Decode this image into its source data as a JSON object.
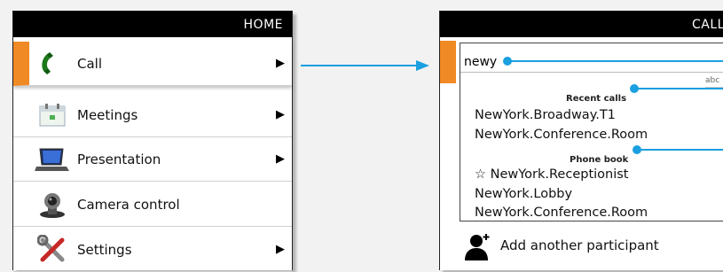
{
  "home": {
    "title": "HOME",
    "items": [
      {
        "label": "Call",
        "icon": "phone-icon",
        "active": true,
        "has_arrow": true
      },
      {
        "label": "Meetings",
        "icon": "calendar-icon",
        "active": false,
        "has_arrow": true
      },
      {
        "label": "Presentation",
        "icon": "laptop-icon",
        "active": false,
        "has_arrow": true
      },
      {
        "label": "Camera control",
        "icon": "camera-icon",
        "active": false,
        "has_arrow": false
      },
      {
        "label": "Settings",
        "icon": "tools-icon",
        "active": false,
        "has_arrow": true
      }
    ],
    "arrow_glyph": "▶"
  },
  "call": {
    "title": "CALL",
    "search_value": "newy",
    "keyboard_hint": "abc",
    "recent_calls_label": "Recent calls",
    "phone_book_label": "Phone book",
    "recent_calls": [
      "NewYork.Broadway.T1",
      "NewYork.Conference.Room"
    ],
    "phone_book": [
      {
        "label": "NewYork.Receptionist",
        "favorite": true
      },
      {
        "label": "NewYork.Lobby",
        "favorite": false
      },
      {
        "label": "NewYork.Conference.Room",
        "favorite": false
      }
    ],
    "star_glyph": "☆",
    "add_participant_label": "Add another participant"
  },
  "colors": {
    "accent": "#f08a24",
    "callout": "#1a9fe0",
    "header_bg": "#000000"
  }
}
